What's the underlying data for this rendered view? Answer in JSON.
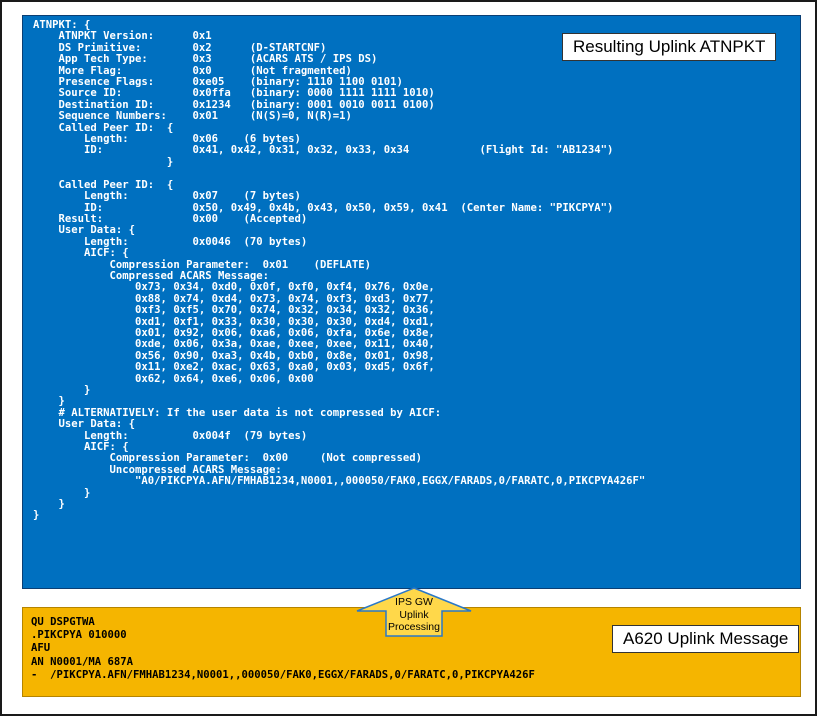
{
  "atnpkt_code": "ATNPKT: {\n    ATNPKT Version:      0x1\n    DS Primitive:        0x2      (D-STARTCNF)\n    App Tech Type:       0x3      (ACARS ATS / IPS DS)\n    More Flag:           0x0      (Not fragmented)\n    Presence Flags:      0xe05    (binary: 1110 1100 0101)\n    Source ID:           0x0ffa   (binary: 0000 1111 1111 1010)\n    Destination ID:      0x1234   (binary: 0001 0010 0011 0100)\n    Sequence Numbers:    0x01     (N(S)=0, N(R)=1)\n    Called Peer ID:  {\n        Length:          0x06    (6 bytes)\n        ID:              0x41, 0x42, 0x31, 0x32, 0x33, 0x34           (Flight Id: \"AB1234\")\n                     }\n\n    Called Peer ID:  {\n        Length:          0x07    (7 bytes)\n        ID:              0x50, 0x49, 0x4b, 0x43, 0x50, 0x59, 0x41  (Center Name: \"PIKCPYA\")\n    Result:              0x00    (Accepted)\n    User Data: {\n        Length:          0x0046  (70 bytes)\n        AICF: {\n            Compression Parameter:  0x01    (DEFLATE)\n            Compressed ACARS Message:\n                0x73, 0x34, 0xd0, 0x0f, 0xf0, 0xf4, 0x76, 0x0e,\n                0x88, 0x74, 0xd4, 0x73, 0x74, 0xf3, 0xd3, 0x77,\n                0xf3, 0xf5, 0x70, 0x74, 0x32, 0x34, 0x32, 0x36,\n                0xd1, 0xf1, 0x33, 0x30, 0x30, 0x30, 0xd4, 0xd1,\n                0x01, 0x92, 0x06, 0xa6, 0x06, 0xfa, 0x6e, 0x8e,\n                0xde, 0x06, 0x3a, 0xae, 0xee, 0xee, 0x11, 0x40,\n                0x56, 0x90, 0xa3, 0x4b, 0xb0, 0x8e, 0x01, 0x98,\n                0x11, 0xe2, 0xac, 0x63, 0xa0, 0x03, 0xd5, 0x6f,\n                0x62, 0x64, 0xe6, 0x06, 0x00\n        }\n    }\n    # ALTERNATIVELY: If the user data is not compressed by AICF:\n    User Data: {\n        Length:          0x004f  (79 bytes)\n        AICF: {\n            Compression Parameter:  0x00     (Not compressed)\n            Uncompressed ACARS Message:\n                \"A0/PIKCPYA.AFN/FMHAB1234,N0001,,000050/FAK0,EGGX/FARADS,0/FARATC,0,PIKCPYA426F\"\n        }\n    }\n}",
  "uplink_title": "Resulting Uplink ATNPKT",
  "arrow_label": "IPS GW\nUplink\nProcessing",
  "a620_code": "QU DSPGTWA\n.PIKCPYA 010000\nAFU\nAN N0001/MA 687A\n-  /PIKCPYA.AFN/FMHAB1234,N0001,,000050/FAK0,EGGX/FARADS,0/FARATC,0,PIKCPYA426F",
  "a620_title": "A620 Uplink Message",
  "colors": {
    "blue_panel": "#0070c0",
    "yellow_panel": "#f5b500",
    "arrow_fill": "#ffd84a",
    "arrow_stroke": "#2a78c8"
  }
}
